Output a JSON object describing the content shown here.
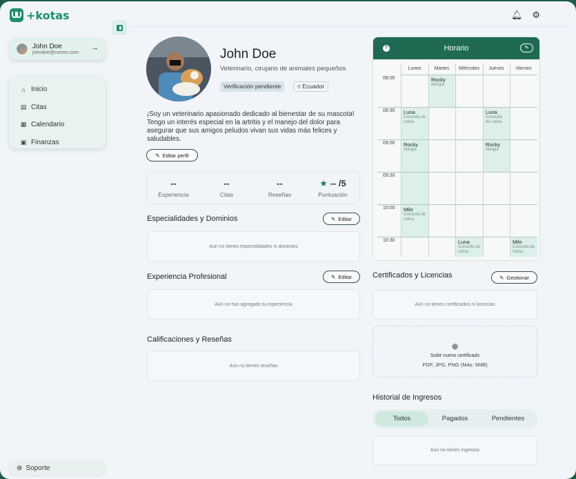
{
  "app": {
    "logo_text": "+kotas"
  },
  "user": {
    "name": "John Doe",
    "email": "johndoe@correo.com"
  },
  "nav": {
    "items": [
      "Inicio",
      "Citas",
      "Calendario",
      "Finanzas"
    ],
    "support": "Soporte"
  },
  "profile": {
    "name": "John Doe",
    "title": "Veterinario, cirujano de animales pequeños",
    "verification": "Verificación pendiente",
    "country": "Ecuador",
    "bio": "¡Soy un veterinario apasionado dedicado al bienestar de su mascota! Tengo un interés especial en la artritis y el manejo del dolor para asegurar que sus amigos peludos vivan sus vidas más felices y saludables.",
    "edit_label": "Editar perfil"
  },
  "stats": [
    {
      "value": "--",
      "label": "Experiencia"
    },
    {
      "value": "--",
      "label": "Citas"
    },
    {
      "value": "--",
      "label": "Reseñas"
    },
    {
      "value": "-- /5",
      "label": "Puntuación"
    }
  ],
  "specialties": {
    "title": "Especialidades y Dominios",
    "edit": "Editar",
    "empty": "Aún no tienes especialidades ni dominios"
  },
  "experience": {
    "title": "Experiencia Profesional",
    "edit": "Editar",
    "empty": "Aún no has agregado tu experiencia"
  },
  "reviews": {
    "title": "Calificaciones y Reseñas",
    "empty": "Aún no tienes reseñas"
  },
  "schedule": {
    "title": "Horario",
    "days": [
      "Lunes",
      "Martes",
      "Miércoles",
      "Jueves",
      "Viernes"
    ],
    "times": [
      "08:00",
      "08:30",
      "09:00",
      "09:30",
      "10:00",
      "10:30"
    ],
    "appointments": [
      {
        "name": "Rocky",
        "detail": "Alergia"
      },
      {
        "name": "Luna",
        "detail": "Consulta de rutina"
      },
      {
        "name": "Luna",
        "detail": "Consulta de rutina"
      },
      {
        "name": "Rocky",
        "detail": "Alergia"
      },
      {
        "name": "Rocky",
        "detail": "Alergia"
      },
      {
        "name": "Milo",
        "detail": "Consulta de rutina"
      },
      {
        "name": "Luna",
        "detail": "Consulta de rutina"
      },
      {
        "name": "Milo",
        "detail": "Consulta de rutina"
      }
    ]
  },
  "certificates": {
    "title": "Certificados y Licencias",
    "manage": "Gestionar",
    "empty": "Aún no tienes certificados ni licencias",
    "upload_title": "Subir nuevo certificado",
    "upload_formats": "PDF, JPG, PNG (Máx: 5MB)"
  },
  "income": {
    "title": "Historial de Ingresos",
    "tabs": [
      "Todos",
      "Pagados",
      "Pendientes"
    ],
    "empty": "Aún no tienes ingresos"
  },
  "colors": {
    "brand": "#1e8f6b",
    "header": "#1e6a52",
    "slot": "#dcefea"
  }
}
